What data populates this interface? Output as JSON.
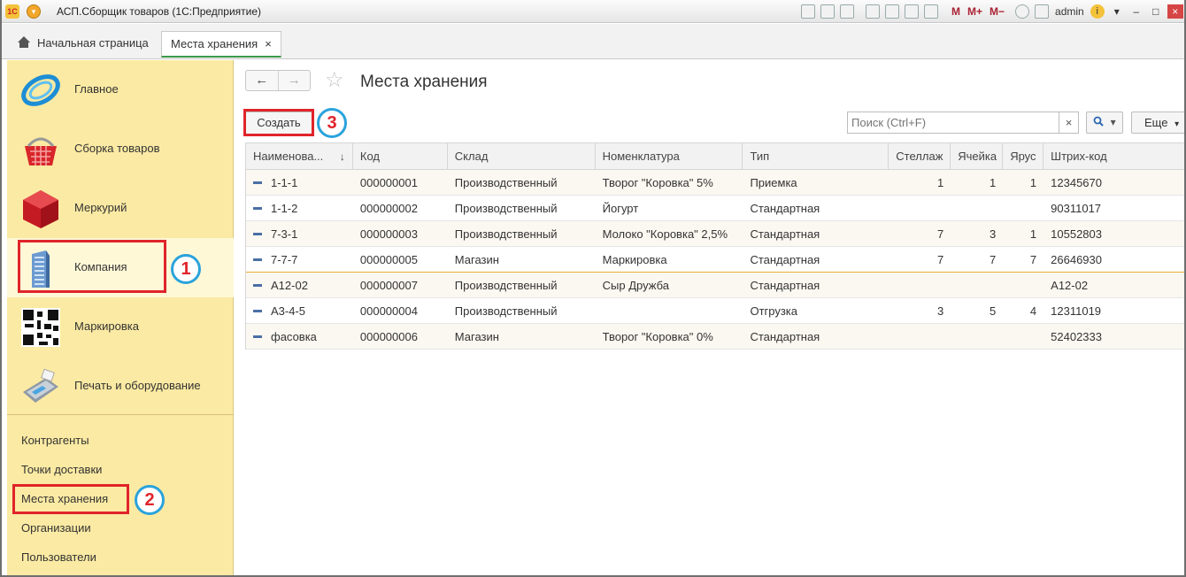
{
  "titlebar": {
    "logo": "1С",
    "title": "АСП.Сборщик товаров (1С:Предприятие)",
    "m": "M",
    "mplus": "M+",
    "mminus": "M−",
    "user": "admin"
  },
  "tabs": {
    "home": "Начальная страница",
    "active": "Места хранения",
    "close": "×"
  },
  "sidebar": {
    "sections": [
      {
        "label": "Главное",
        "icon": "swirl-icon"
      },
      {
        "label": "Сборка товаров",
        "icon": "basket-icon"
      },
      {
        "label": "Меркурий",
        "icon": "cube-icon"
      },
      {
        "label": "Компания",
        "icon": "building-icon"
      },
      {
        "label": "Маркировка",
        "icon": "qr-code-icon"
      },
      {
        "label": "Печать и оборудование",
        "icon": "pos-terminal-icon"
      }
    ],
    "links": [
      "Контрагенты",
      "Точки доставки",
      "Места хранения",
      "Организации",
      "Пользователи"
    ]
  },
  "markers": [
    "1",
    "2",
    "3"
  ],
  "main": {
    "title": "Места хранения",
    "create_label": "Создать",
    "search_placeholder": "Поиск (Ctrl+F)",
    "clear": "×",
    "more_label": "Еще"
  },
  "table": {
    "columns": [
      "Наименова...",
      "Код",
      "Склад",
      "Номенклатура",
      "Тип",
      "Стеллаж",
      "Ячейка",
      "Ярус",
      "Штрих-код"
    ],
    "rows": [
      [
        "1-1-1",
        "000000001",
        "Производственный",
        "Творог \"Коровка\" 5%",
        "Приемка",
        "1",
        "1",
        "1",
        "12345670"
      ],
      [
        "1-1-2",
        "000000002",
        "Производственный",
        "Йогурт",
        "Стандартная",
        "",
        "",
        "",
        "90311017"
      ],
      [
        "7-3-1",
        "000000003",
        "Производственный",
        "Молоко \"Коровка\" 2,5%",
        "Стандартная",
        "7",
        "3",
        "1",
        "10552803"
      ],
      [
        "7-7-7",
        "000000005",
        "Магазин",
        "Маркировка",
        "Стандартная",
        "7",
        "7",
        "7",
        "26646930"
      ],
      [
        "А12-02",
        "000000007",
        "Производственный",
        "Сыр Дружба",
        "Стандартная",
        "",
        "",
        "",
        "А12-02"
      ],
      [
        "А3-4-5",
        "000000004",
        "Производственный",
        "",
        "Отгрузка",
        "3",
        "5",
        "4",
        "12311019"
      ],
      [
        "фасовка",
        "000000006",
        "Магазин",
        "Творог \"Коровка\" 0%",
        "Стандартная",
        "",
        "",
        "",
        "52402333"
      ]
    ]
  }
}
